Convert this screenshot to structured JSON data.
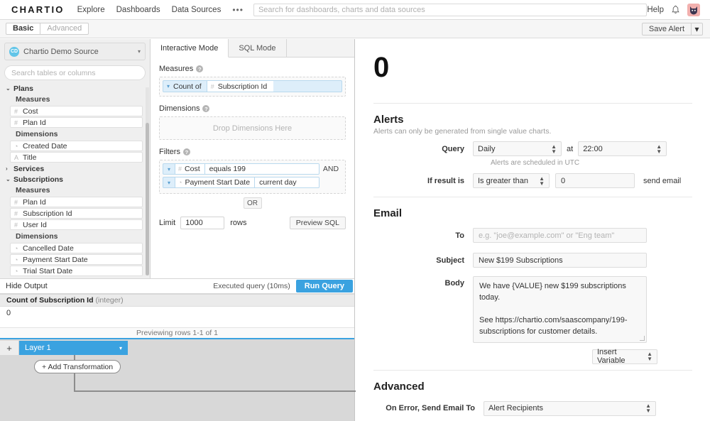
{
  "topnav": {
    "logo": "CHARTIO",
    "links": [
      "Explore",
      "Dashboards",
      "Data Sources"
    ],
    "overflow": "•••",
    "search_placeholder": "Search for dashboards, charts and data sources",
    "help": "Help",
    "bell_icon": "bell-icon",
    "avatar_icon": "cat-avatar"
  },
  "modebar": {
    "basic": "Basic",
    "advanced": "Advanced",
    "save_alert": "Save Alert",
    "save_alert_caret": "▾"
  },
  "schema": {
    "source_name": "Chartio Demo Source",
    "source_initials": "CD",
    "source_caret": "▾",
    "search_placeholder": "Search tables or columns",
    "tables": [
      {
        "name": "Plans",
        "expanded": true,
        "toggle": "⌄",
        "groups": [
          {
            "label": "Measures",
            "fields": [
              {
                "name": "Cost",
                "icon": "#"
              },
              {
                "name": "Plan Id",
                "icon": "#"
              }
            ]
          },
          {
            "label": "Dimensions",
            "fields": [
              {
                "name": "Created Date",
                "icon": "◔"
              },
              {
                "name": "Title",
                "icon": "A"
              }
            ]
          }
        ]
      },
      {
        "name": "Services",
        "expanded": false,
        "toggle": "›",
        "groups": []
      },
      {
        "name": "Subscriptions",
        "expanded": true,
        "toggle": "⌄",
        "groups": [
          {
            "label": "Measures",
            "fields": [
              {
                "name": "Plan Id",
                "icon": "#"
              },
              {
                "name": "Subscription Id",
                "icon": "#"
              },
              {
                "name": "User Id",
                "icon": "#"
              }
            ]
          },
          {
            "label": "Dimensions",
            "fields": [
              {
                "name": "Cancelled Date",
                "icon": "◔"
              },
              {
                "name": "Payment Start Date",
                "icon": "◔"
              },
              {
                "name": "Trial Start Date",
                "icon": "◔"
              }
            ]
          }
        ]
      }
    ]
  },
  "query": {
    "tabs": [
      {
        "label": "Interactive Mode",
        "active": true
      },
      {
        "label": "SQL Mode",
        "active": false
      }
    ],
    "measures_label": "Measures",
    "measure": {
      "caret": "▾",
      "aggregate": "Count of",
      "field_icon": "#",
      "field": "Subscription Id"
    },
    "dimensions_label": "Dimensions",
    "dimensions_placeholder": "Drop Dimensions Here",
    "filters_label": "Filters",
    "filters": [
      {
        "caret": "▾",
        "field_icon": "#",
        "field": "Cost",
        "value": "equals 199",
        "joiner": "AND"
      },
      {
        "caret": "▾",
        "field_icon": "◔",
        "field": "Payment Start Date",
        "value": "current day",
        "joiner": ""
      }
    ],
    "or_button": "OR",
    "limit_label": "Limit",
    "limit_value": "1000",
    "rows_label": "rows",
    "preview_sql": "Preview SQL"
  },
  "output": {
    "hide_output": "Hide Output",
    "executed": "Executed query (10ms)",
    "run_query": "Run Query",
    "column_header": "Count of Subscription Id",
    "column_type": "(integer)",
    "cell_value": "0",
    "preview_rows": "Previewing rows 1-1 of 1"
  },
  "layers": {
    "add_layer": "+",
    "layer_name": "Layer 1",
    "layer_caret": "▾",
    "add_transformation": "+ Add Transformation"
  },
  "chart": {
    "value": "0"
  },
  "alerts": {
    "title": "Alerts",
    "subtitle": "Alerts can only be generated from single value charts.",
    "query_label": "Query",
    "frequency": "Daily",
    "at_label": "at",
    "time": "22:00",
    "schedule_hint": "Alerts are scheduled in UTC",
    "condition_label": "If result is",
    "comparator": "Is greater than",
    "threshold": "0",
    "send_email": "send email"
  },
  "email": {
    "title": "Email",
    "to_label": "To",
    "to_placeholder": "e.g. \"joe@example.com\" or \"Eng team\"",
    "subject_label": "Subject",
    "subject_value": "New $199 Subscriptions",
    "body_label": "Body",
    "body_value": "We have {VALUE} new $199 subscriptions today.\n\nSee https://chartio.com/saascompany/199-subscriptions for customer details.",
    "insert_variable": "Insert Variable"
  },
  "advanced": {
    "title": "Advanced",
    "on_error_label": "On Error, Send Email To",
    "on_error_value": "Alert Recipients"
  },
  "colors": {
    "accent": "#3aa2e0",
    "pill": "#ddeefa",
    "pill_border": "#b9d9ee",
    "avatar_bg": "#f2b0ae"
  }
}
